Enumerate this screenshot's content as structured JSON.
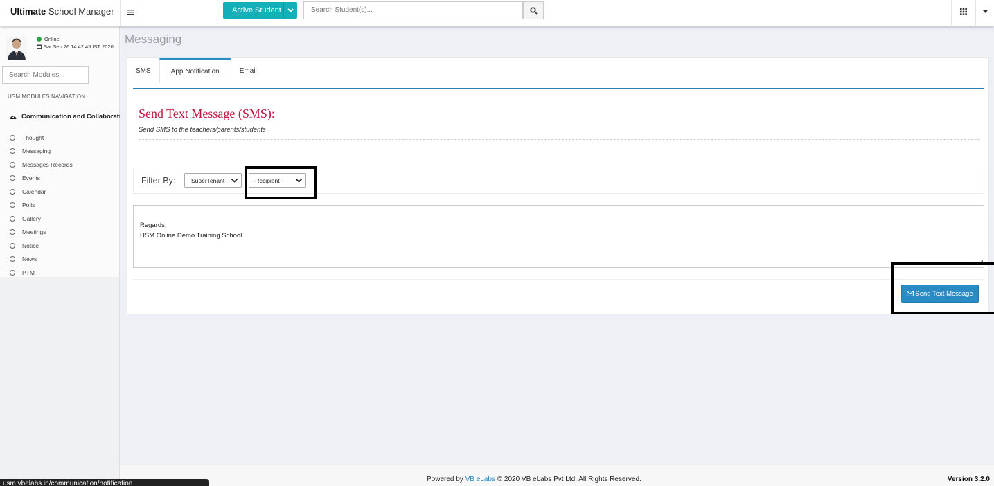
{
  "app": {
    "brand_bold": "Ultimate",
    "brand_rest": " School Manager"
  },
  "topbar": {
    "active_student_label": "Active Student",
    "search_placeholder": "Search Student(s)..."
  },
  "sidebar": {
    "status": "Online",
    "datetime": "Sat Sep 26 14:42:45 IST 2020",
    "module_search_placeholder": "Search Modules...",
    "nav_heading": "USM MODULES NAVIGATION",
    "group_label": "Communication and Collaboration",
    "items": [
      {
        "label": "Thought"
      },
      {
        "label": "Messaging"
      },
      {
        "label": "Messages Records"
      },
      {
        "label": "Events"
      },
      {
        "label": "Calendar"
      },
      {
        "label": "Polls"
      },
      {
        "label": "Gallery"
      },
      {
        "label": "Meetings"
      },
      {
        "label": "Notice"
      },
      {
        "label": "News"
      },
      {
        "label": "PTM"
      }
    ]
  },
  "main": {
    "page_title": "Messaging",
    "tabs": [
      {
        "label": "SMS"
      },
      {
        "label": "App Notification"
      },
      {
        "label": "Email"
      }
    ],
    "sms_title": "Send Text Message (SMS):",
    "sms_subtitle": "Send SMS to the teachers/parents/students",
    "filter_label": "Filter By:",
    "tenant_select": "SuperTenant",
    "recipient_select": "- Recipient -",
    "message_line1": "Regards,",
    "message_line2": "USM Online Demo Training School",
    "send_button": "Send Text Message"
  },
  "footer": {
    "powered_by": "Powered by",
    "link_text": "VB eLabs",
    "copyright": "© 2020 VB eLabs Pvt Ltd. All Rights Reserved.",
    "version": "Version 3.2.0"
  },
  "statusbar": {
    "url_text": "usm.vbelabs.in/communication/notification"
  },
  "colors": {
    "accent_teal": "#13b0b9",
    "primary_blue": "#2a8ac4",
    "title_red": "#c0143c",
    "online_green": "#2aa944"
  }
}
